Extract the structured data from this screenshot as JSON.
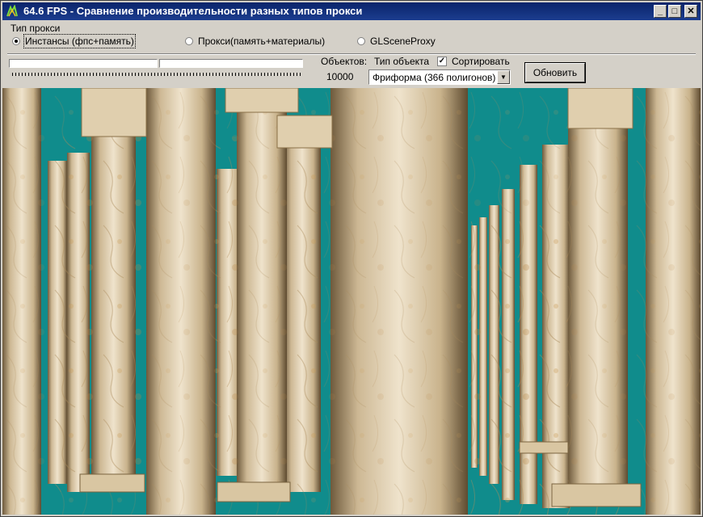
{
  "window": {
    "title": "64.6 FPS - Сравнение производительности разных типов прокси",
    "buttons": {
      "minimize": "_",
      "maximize": "□",
      "close": "✕"
    }
  },
  "proxy_group": {
    "label": "Тип прокси",
    "options": [
      {
        "label": "Инстансы (фпс+память)",
        "selected": true
      },
      {
        "label": "Прокси(память+материалы)",
        "selected": false
      },
      {
        "label": "GLSceneProxy",
        "selected": false
      }
    ]
  },
  "objects": {
    "label": "Объектов:",
    "value": "10000"
  },
  "object_type": {
    "label": "Тип объекта",
    "selected": "Фриформа (366 полигонов)"
  },
  "sort": {
    "label": "Сортировать",
    "checked": true
  },
  "refresh_button": "Обновить",
  "colors": {
    "titlebar": "#0a246a",
    "viewport_bg": "#108c8c",
    "marble": "#e3d3b6"
  }
}
